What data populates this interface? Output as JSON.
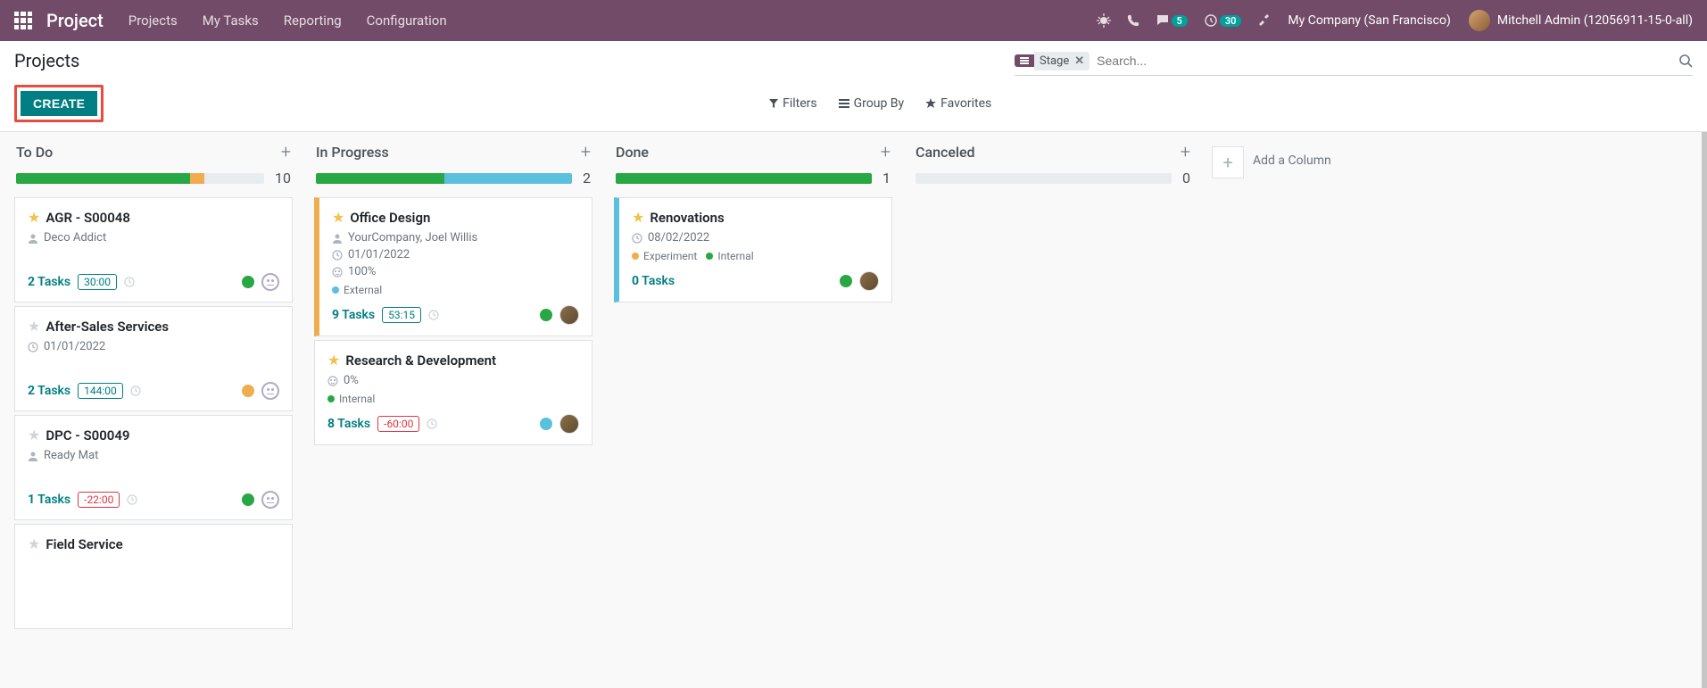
{
  "navbar": {
    "brand": "Project",
    "menu": [
      "Projects",
      "My Tasks",
      "Reporting",
      "Configuration"
    ],
    "messages_badge": "5",
    "activities_badge": "30",
    "company": "My Company (San Francisco)",
    "user": "Mitchell Admin (12056911-15-0-all)"
  },
  "breadcrumb": "Projects",
  "search": {
    "group_label": "Stage",
    "placeholder": "Search..."
  },
  "search_options": {
    "filters": "Filters",
    "groupby": "Group By",
    "favorites": "Favorites"
  },
  "buttons": {
    "create": "CREATE"
  },
  "add_column": "Add a Column",
  "columns": [
    {
      "title": "To Do",
      "count": "10",
      "progress": [
        {
          "color": "#28a745",
          "pct": 70
        },
        {
          "color": "#f0ad4e",
          "pct": 6
        },
        {
          "color": "#e9ecef",
          "pct": 24
        }
      ],
      "cards": [
        {
          "edge": "",
          "star": true,
          "title": "AGR - S00048",
          "metas": [
            {
              "icon": "user",
              "text": "Deco Addict"
            }
          ],
          "tags": [],
          "tasks_n": "2",
          "tasks_w": "Tasks",
          "hours": "30:00",
          "hours_neg": false,
          "status_color": "#28a745",
          "face": true,
          "avatar": false
        },
        {
          "edge": "",
          "star": false,
          "title": "After-Sales Services",
          "metas": [
            {
              "icon": "clock",
              "text": "01/01/2022"
            }
          ],
          "tags": [],
          "tasks_n": "2",
          "tasks_w": "Tasks",
          "hours": "144:00",
          "hours_neg": false,
          "status_color": "#f0ad4e",
          "face": true,
          "avatar": false
        },
        {
          "edge": "",
          "star": false,
          "title": "DPC - S00049",
          "metas": [
            {
              "icon": "user",
              "text": "Ready Mat"
            }
          ],
          "tags": [],
          "tasks_n": "1",
          "tasks_w": "Tasks",
          "hours": "-22:00",
          "hours_neg": true,
          "status_color": "#28a745",
          "face": true,
          "avatar": false
        },
        {
          "edge": "",
          "star": false,
          "title": "Field Service",
          "metas": [],
          "tags": [],
          "tasks_n": "",
          "tasks_w": "",
          "hours": "",
          "hours_neg": false,
          "status_color": "",
          "face": false,
          "avatar": false
        }
      ]
    },
    {
      "title": "In Progress",
      "count": "2",
      "progress": [
        {
          "color": "#28a745",
          "pct": 50
        },
        {
          "color": "#5bc0de",
          "pct": 50
        },
        {
          "color": "#e9ecef",
          "pct": 0
        }
      ],
      "cards": [
        {
          "edge": "edge-yellow",
          "star": true,
          "title": "Office Design",
          "metas": [
            {
              "icon": "user",
              "text": "YourCompany, Joel Willis"
            },
            {
              "icon": "clock",
              "text": "01/01/2022"
            },
            {
              "icon": "smile",
              "text": "100%"
            }
          ],
          "tags": [
            {
              "color": "#5bc0de",
              "text": "External"
            }
          ],
          "tasks_n": "9",
          "tasks_w": "Tasks",
          "hours": "53:15",
          "hours_neg": false,
          "status_color": "#28a745",
          "face": false,
          "avatar": true
        },
        {
          "edge": "",
          "star": true,
          "title": "Research & Development",
          "metas": [
            {
              "icon": "smile",
              "text": "0%"
            }
          ],
          "tags": [
            {
              "color": "#28a745",
              "text": "Internal"
            }
          ],
          "tasks_n": "8",
          "tasks_w": "Tasks",
          "hours": "-60:00",
          "hours_neg": true,
          "status_color": "#5bc0de",
          "face": false,
          "avatar": true
        }
      ]
    },
    {
      "title": "Done",
      "count": "1",
      "progress": [
        {
          "color": "#28a745",
          "pct": 100
        }
      ],
      "cards": [
        {
          "edge": "edge-blue",
          "star": true,
          "title": "Renovations",
          "metas": [
            {
              "icon": "clock",
              "text": "08/02/2022"
            }
          ],
          "tags": [
            {
              "color": "#f0ad4e",
              "text": "Experiment"
            },
            {
              "color": "#28a745",
              "text": "Internal"
            }
          ],
          "tasks_n": "0",
          "tasks_w": "Tasks",
          "hours": "",
          "hours_neg": false,
          "status_color": "#28a745",
          "face": false,
          "avatar": true
        }
      ]
    },
    {
      "title": "Canceled",
      "count": "0",
      "progress": [
        {
          "color": "#e9ecef",
          "pct": 100
        }
      ],
      "cards": []
    }
  ]
}
